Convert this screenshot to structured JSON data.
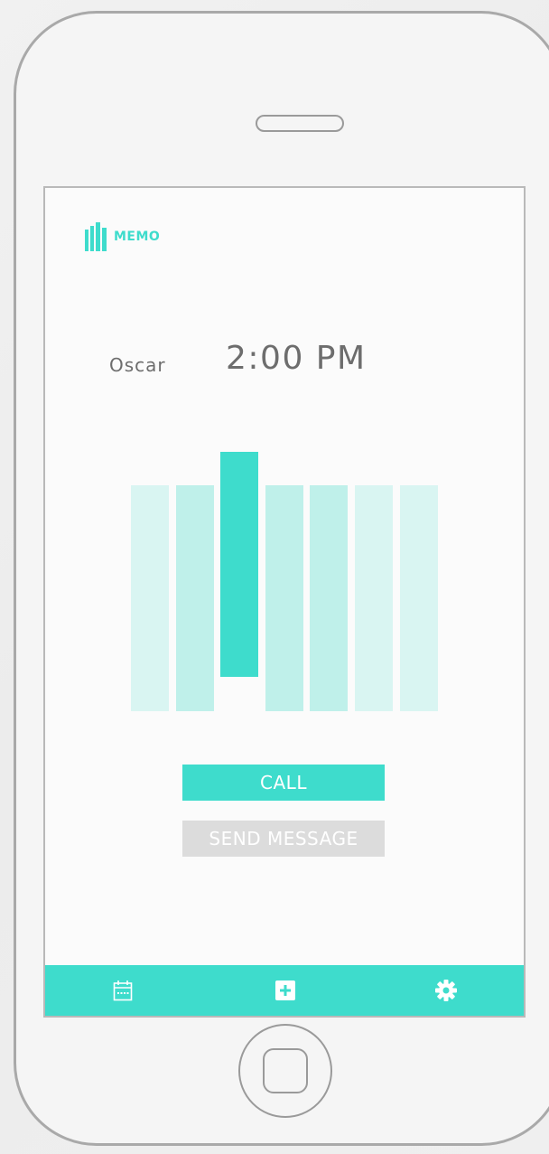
{
  "theme": {
    "accent": "#3edccc",
    "bar_light": "#d9f5f2",
    "bar_medium": "#bff0ea",
    "button_disabled": "#dcdcdc",
    "text": "#6d6d6d"
  },
  "app": {
    "logo_text": "MEMO"
  },
  "reminder": {
    "contact_name": "Oscar",
    "time": "2:00 PM"
  },
  "day_bars": {
    "count": 7,
    "selected_index": 2,
    "shades": [
      "light",
      "medium",
      "selected",
      "medium",
      "medium",
      "light",
      "light"
    ]
  },
  "actions": {
    "call_label": "CALL",
    "send_message_label": "SEND MESSAGE"
  },
  "tabbar": {
    "icons": [
      "calendar-icon",
      "add-icon",
      "gear-icon"
    ]
  }
}
